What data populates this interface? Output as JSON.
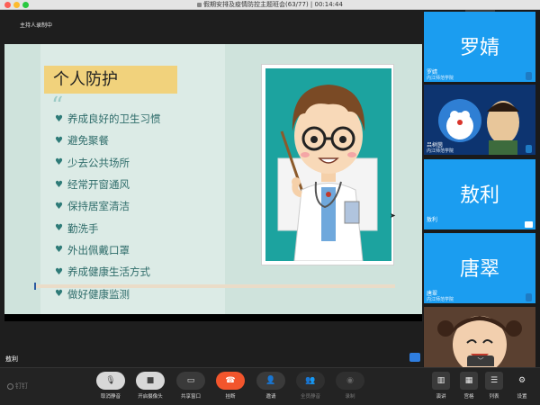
{
  "window": {
    "title": "假期安排及疫情防控主题班会(63/77) | 00:14:44"
  },
  "meeting": {
    "recording_status": "主持人录制中",
    "active_speaker": "敖利"
  },
  "slide": {
    "title": "个人防护",
    "bullets": [
      "养成良好的卫生习惯",
      "避免聚餐",
      "少去公共场所",
      "经常开窗通风",
      "保持居室清洁",
      "勤洗手",
      "外出佩戴口罩",
      "养成健康生活方式",
      "做好健康监测"
    ]
  },
  "participants": [
    {
      "big_name": "罗婧",
      "name": "罗婧",
      "org": "内江师范学院",
      "kind": "avatar",
      "muted": true
    },
    {
      "big_name": "",
      "name": "吕树茵",
      "org": "内江师范学院",
      "kind": "video",
      "muted": true
    },
    {
      "big_name": "敖利",
      "name": "敖利",
      "org": "",
      "kind": "avatar",
      "sharing": true
    },
    {
      "big_name": "唐翠",
      "name": "唐翠",
      "org": "内江师范学院",
      "kind": "avatar",
      "muted": true
    },
    {
      "big_name": "",
      "name": "",
      "org": "",
      "kind": "video"
    }
  ],
  "toolbar": {
    "brand": "钉钉",
    "buttons": {
      "mute": "取消静音",
      "camera": "开启摄像头",
      "share": "共享窗口",
      "hangup": "挂断",
      "invite": "邀请",
      "mute_all": "全员静音",
      "record": "录制"
    },
    "views": {
      "speaker": "演讲",
      "grid": "宫格",
      "list": "列表",
      "settings": "设置"
    }
  },
  "icons": {
    "up_chevron": "chevron-up-icon",
    "down_chevron": "chevron-down-icon"
  },
  "colors": {
    "tile_blue": "#1b9df0",
    "hangup_red": "#f2552c",
    "slide_bg": "#cfe3dc",
    "title_highlight": "#f1d27c",
    "bullet_teal": "#2e6c6a"
  }
}
